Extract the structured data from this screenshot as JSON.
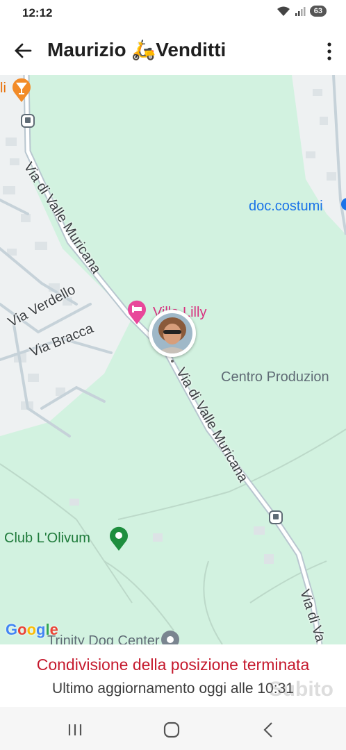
{
  "status_bar": {
    "time": "12:12",
    "battery": "63"
  },
  "header": {
    "title": "Maurizio 🛵Venditti"
  },
  "map": {
    "roads": [
      "Via di Valle Muricana",
      "Via di Valle Muricana",
      "Via di Va",
      "Via Verdello",
      "Via Bracca"
    ],
    "pois": [
      "Villa Lilly",
      "doc.costumi",
      "Centro Produzion",
      "Club L'Olivum",
      "Trinity Dog Center",
      "li"
    ],
    "brand": "Google"
  },
  "banner": {
    "title": "Condivisione della posizione terminata",
    "subtitle": "Ultimo aggiornamento oggi alle 10:31"
  },
  "watermark": "Subito",
  "colors": {
    "map_green": "#d2f2e0",
    "road_grey": "#b8c6cf",
    "poi_pink": "#e8489a",
    "poi_green": "#1e8e3e",
    "poi_blue": "#1a73e8",
    "alert_red": "#c5192d"
  }
}
